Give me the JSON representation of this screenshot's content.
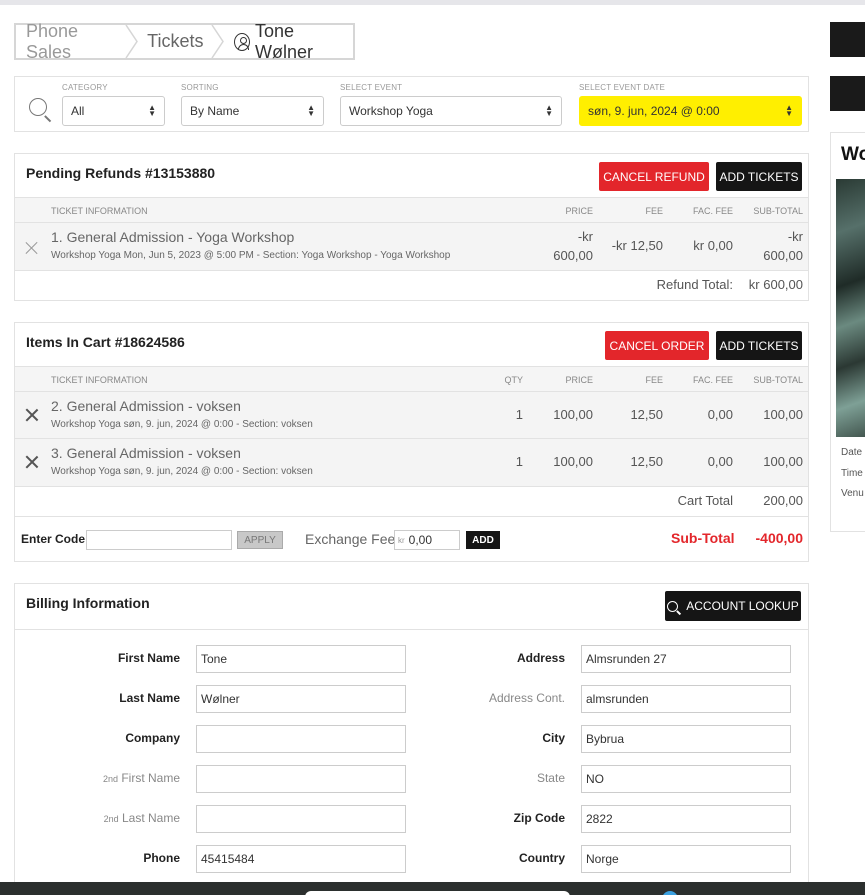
{
  "breadcrumb": [
    "Phone Sales",
    "Tickets",
    "Tone Wølner"
  ],
  "filters": {
    "category": {
      "label": "CATEGORY",
      "value": "All"
    },
    "sorting": {
      "label": "SORTING",
      "value": "By Name"
    },
    "event": {
      "label": "SELECT EVENT",
      "value": "Workshop Yoga"
    },
    "date": {
      "label": "SELECT EVENT DATE",
      "value": "søn, 9. jun, 2024 @ 0:00"
    }
  },
  "refunds": {
    "title": "Pending Refunds #13153880",
    "cancel_label": "CANCEL REFUND",
    "add_label": "ADD TICKETS",
    "headers": {
      "info": "TICKET INFORMATION",
      "price": "PRICE",
      "fee": "FEE",
      "fac_fee": "FAC. FEE",
      "subtotal": "SUB-TOTAL"
    },
    "rows": [
      {
        "name": "1. General Admission - Yoga Workshop",
        "sub": "Workshop Yoga Mon, Jun 5, 2023 @ 5:00 PM - Section: Yoga Workshop - Yoga Workshop",
        "price_l1": "-kr",
        "price_l2": "600,00",
        "fee": "-kr 12,50",
        "fac_fee": "kr 0,00",
        "subtotal_l1": "-kr",
        "subtotal_l2": "600,00"
      }
    ],
    "total_label": "Refund Total:",
    "total_value": "kr 600,00"
  },
  "cart": {
    "title": "Items In Cart #18624586",
    "cancel_label": "CANCEL ORDER",
    "add_label": "ADD TICKETS",
    "headers": {
      "info": "TICKET INFORMATION",
      "qty": "QTY",
      "price": "PRICE",
      "fee": "FEE",
      "fac_fee": "FAC. FEE",
      "subtotal": "SUB-TOTAL"
    },
    "rows": [
      {
        "name": "2. General Admission - voksen",
        "sub": "Workshop Yoga søn, 9. jun, 2024 @ 0:00 - Section: voksen",
        "qty": "1",
        "price": "100,00",
        "fee": "12,50",
        "fac_fee": "0,00",
        "subtotal": "100,00"
      },
      {
        "name": "3. General Admission - voksen",
        "sub": "Workshop Yoga søn, 9. jun, 2024 @ 0:00 - Section: voksen",
        "qty": "1",
        "price": "100,00",
        "fee": "12,50",
        "fac_fee": "0,00",
        "subtotal": "100,00"
      }
    ],
    "total_label": "Cart Total",
    "total_value": "200,00",
    "code_label": "Enter Code",
    "apply_label": "APPLY",
    "exchange_label": "Exchange Fee",
    "exchange_currency": "kr",
    "exchange_value": "0,00",
    "exchange_add": "ADD",
    "subtotal_label": "Sub-Total",
    "subtotal_value": "-400,00"
  },
  "billing": {
    "title": "Billing Information",
    "lookup_label": "ACCOUNT LOOKUP",
    "first_name": {
      "label": "First Name",
      "value": "Tone"
    },
    "last_name": {
      "label": "Last Name",
      "value": "Wølner"
    },
    "company": {
      "label": "Company",
      "value": ""
    },
    "second_first": {
      "prefix": "2nd",
      "label": "First Name",
      "value": ""
    },
    "second_last": {
      "prefix": "2nd",
      "label": "Last Name",
      "value": ""
    },
    "phone": {
      "label": "Phone",
      "value": "45415484"
    },
    "address": {
      "label": "Address",
      "value": "Almsrunden 27"
    },
    "address2": {
      "label": "Address Cont.",
      "value": "almsrunden"
    },
    "city": {
      "label": "City",
      "value": "Bybrua"
    },
    "state": {
      "label": "State",
      "value": "NO"
    },
    "zip": {
      "label": "Zip Code",
      "value": "2822"
    },
    "country": {
      "label": "Country",
      "value": "Norge"
    }
  },
  "side": {
    "title": "Wo",
    "meta": [
      "Date",
      "Time",
      "Venu"
    ]
  }
}
